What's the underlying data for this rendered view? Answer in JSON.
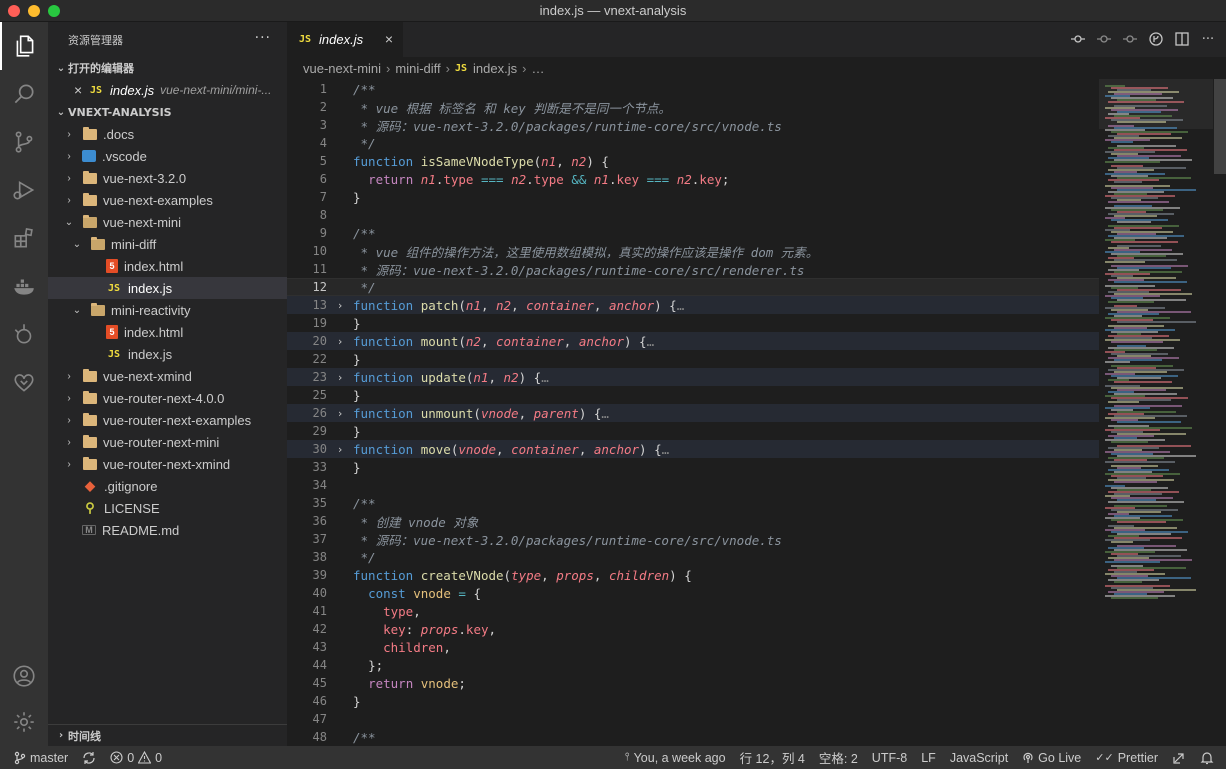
{
  "window": {
    "title": "index.js — vnext-analysis"
  },
  "activity_bar": {
    "items": [
      {
        "name": "explorer-icon"
      },
      {
        "name": "search-icon"
      },
      {
        "name": "source-control-icon"
      },
      {
        "name": "run-debug-icon"
      },
      {
        "name": "extensions-icon"
      },
      {
        "name": "docker-icon"
      },
      {
        "name": "git-graph-icon"
      },
      {
        "name": "live-share-icon"
      }
    ],
    "bottom": [
      {
        "name": "account-icon"
      },
      {
        "name": "settings-gear-icon"
      }
    ]
  },
  "sidebar": {
    "header": "资源管理器",
    "header_more": "···",
    "open_editors": {
      "title": "打开的编辑器",
      "items": [
        {
          "close": "×",
          "name": "index.js",
          "path": "vue-next-mini/mini-..."
        }
      ]
    },
    "workspace": {
      "title": "VNEXT-ANALYSIS",
      "tree": [
        {
          "label": ".docs",
          "icon": "folder-icon",
          "depth": 1,
          "chevron": "›"
        },
        {
          "label": ".vscode",
          "icon": "vscode-folder-icon",
          "depth": 1,
          "chevron": "›"
        },
        {
          "label": "vue-next-3.2.0",
          "icon": "folder-icon",
          "depth": 1,
          "chevron": "›"
        },
        {
          "label": "vue-next-examples",
          "icon": "folder-icon",
          "depth": 1,
          "chevron": "›"
        },
        {
          "label": "vue-next-mini",
          "icon": "folder-open-icon",
          "depth": 1,
          "chevron": "⌄"
        },
        {
          "label": "mini-diff",
          "icon": "folder-open-icon",
          "depth": 2,
          "chevron": "⌄"
        },
        {
          "label": "index.html",
          "icon": "html-file-icon",
          "depth": 3,
          "chevron": ""
        },
        {
          "label": "index.js",
          "icon": "js-file-icon",
          "depth": 3,
          "chevron": "",
          "selected": true
        },
        {
          "label": "mini-reactivity",
          "icon": "folder-open-icon",
          "depth": 2,
          "chevron": "⌄"
        },
        {
          "label": "index.html",
          "icon": "html-file-icon",
          "depth": 3,
          "chevron": ""
        },
        {
          "label": "index.js",
          "icon": "js-file-icon",
          "depth": 3,
          "chevron": ""
        },
        {
          "label": "vue-next-xmind",
          "icon": "folder-icon",
          "depth": 1,
          "chevron": "›"
        },
        {
          "label": "vue-router-next-4.0.0",
          "icon": "folder-icon",
          "depth": 1,
          "chevron": "›"
        },
        {
          "label": "vue-router-next-examples",
          "icon": "folder-icon",
          "depth": 1,
          "chevron": "›"
        },
        {
          "label": "vue-router-next-mini",
          "icon": "folder-icon",
          "depth": 1,
          "chevron": "›"
        },
        {
          "label": "vue-router-next-xmind",
          "icon": "folder-icon",
          "depth": 1,
          "chevron": "›"
        },
        {
          "label": ".gitignore",
          "icon": "git-file-icon",
          "depth": 1,
          "chevron": ""
        },
        {
          "label": "LICENSE",
          "icon": "license-file-icon",
          "depth": 1,
          "chevron": ""
        },
        {
          "label": "README.md",
          "icon": "markdown-file-icon",
          "depth": 1,
          "chevron": ""
        }
      ]
    },
    "timeline": "时间线"
  },
  "editor": {
    "tab": {
      "badge": "JS",
      "label": "index.js",
      "close": "×"
    },
    "breadcrumb": [
      "vue-next-mini",
      "mini-diff",
      "index.js",
      "…"
    ],
    "breadcrumb_badge": "JS",
    "actions": [
      "open-changes-icon",
      "previous-change-icon",
      "next-change-icon",
      "git-lens-icon",
      "split-editor-icon",
      "more-actions-icon"
    ],
    "current_line": 12,
    "lines": [
      {
        "n": "1",
        "t": [
          [
            "c-com",
            "/**"
          ]
        ]
      },
      {
        "n": "2",
        "t": [
          [
            "c-com",
            " * vue 根据 标签名 和 key 判断是不是同一个节点。"
          ]
        ]
      },
      {
        "n": "3",
        "t": [
          [
            "c-com",
            " * 源码：vue-next-3.2.0/packages/runtime-core/src/vnode.ts"
          ]
        ]
      },
      {
        "n": "4",
        "t": [
          [
            "c-com",
            " */"
          ]
        ]
      },
      {
        "n": "5",
        "t": [
          [
            "c-kw",
            "function "
          ],
          [
            "c-fn",
            "isSameVNodeType"
          ],
          [
            "c-punc",
            "("
          ],
          [
            "c-par",
            "n1"
          ],
          [
            "c-punc",
            ", "
          ],
          [
            "c-par",
            "n2"
          ],
          [
            "c-punc",
            ") {"
          ]
        ]
      },
      {
        "n": "6",
        "t": [
          [
            "c-def",
            "  "
          ],
          [
            "c-ctl",
            "return "
          ],
          [
            "c-par",
            "n1"
          ],
          [
            "c-punc",
            "."
          ],
          [
            "c-prop",
            "type"
          ],
          [
            "c-op",
            " === "
          ],
          [
            "c-par",
            "n2"
          ],
          [
            "c-punc",
            "."
          ],
          [
            "c-prop",
            "type"
          ],
          [
            "c-op",
            " && "
          ],
          [
            "c-par",
            "n1"
          ],
          [
            "c-punc",
            "."
          ],
          [
            "c-prop",
            "key"
          ],
          [
            "c-op",
            " === "
          ],
          [
            "c-par",
            "n2"
          ],
          [
            "c-punc",
            "."
          ],
          [
            "c-prop",
            "key"
          ],
          [
            "c-punc",
            ";"
          ]
        ]
      },
      {
        "n": "7",
        "t": [
          [
            "c-punc",
            "}"
          ]
        ]
      },
      {
        "n": "8",
        "t": []
      },
      {
        "n": "9",
        "t": [
          [
            "c-com",
            "/**"
          ]
        ]
      },
      {
        "n": "10",
        "t": [
          [
            "c-com",
            " * vue 组件的操作方法，这里使用数组模拟，真实的操作应该是操作 dom 元素。"
          ]
        ]
      },
      {
        "n": "11",
        "t": [
          [
            "c-com",
            " * 源码：vue-next-3.2.0/packages/runtime-core/src/renderer.ts"
          ]
        ]
      },
      {
        "n": "12",
        "t": [
          [
            "c-com",
            " */"
          ]
        ],
        "current": true
      },
      {
        "n": "13",
        "fold": "›",
        "folded": true,
        "t": [
          [
            "c-kw",
            "function "
          ],
          [
            "c-fn",
            "patch"
          ],
          [
            "c-punc",
            "("
          ],
          [
            "c-par",
            "n1"
          ],
          [
            "c-punc",
            ", "
          ],
          [
            "c-par",
            "n2"
          ],
          [
            "c-punc",
            ", "
          ],
          [
            "c-par",
            "container"
          ],
          [
            "c-punc",
            ", "
          ],
          [
            "c-par",
            "anchor"
          ],
          [
            "c-punc",
            ") {"
          ],
          [
            "c-ell",
            "…"
          ]
        ]
      },
      {
        "n": "19",
        "t": [
          [
            "c-punc",
            "}"
          ]
        ]
      },
      {
        "n": "20",
        "fold": "›",
        "folded": true,
        "t": [
          [
            "c-kw",
            "function "
          ],
          [
            "c-fn",
            "mount"
          ],
          [
            "c-punc",
            "("
          ],
          [
            "c-par",
            "n2"
          ],
          [
            "c-punc",
            ", "
          ],
          [
            "c-par",
            "container"
          ],
          [
            "c-punc",
            ", "
          ],
          [
            "c-par",
            "anchor"
          ],
          [
            "c-punc",
            ") {"
          ],
          [
            "c-ell",
            "…"
          ]
        ]
      },
      {
        "n": "22",
        "t": [
          [
            "c-punc",
            "}"
          ]
        ]
      },
      {
        "n": "23",
        "fold": "›",
        "folded": true,
        "t": [
          [
            "c-kw",
            "function "
          ],
          [
            "c-fn",
            "update"
          ],
          [
            "c-punc",
            "("
          ],
          [
            "c-par",
            "n1"
          ],
          [
            "c-punc",
            ", "
          ],
          [
            "c-par",
            "n2"
          ],
          [
            "c-punc",
            ") {"
          ],
          [
            "c-ell",
            "…"
          ]
        ]
      },
      {
        "n": "25",
        "t": [
          [
            "c-punc",
            "}"
          ]
        ]
      },
      {
        "n": "26",
        "fold": "›",
        "folded": true,
        "t": [
          [
            "c-kw",
            "function "
          ],
          [
            "c-fn",
            "unmount"
          ],
          [
            "c-punc",
            "("
          ],
          [
            "c-par",
            "vnode"
          ],
          [
            "c-punc",
            ", "
          ],
          [
            "c-par",
            "parent"
          ],
          [
            "c-punc",
            ") {"
          ],
          [
            "c-ell",
            "…"
          ]
        ]
      },
      {
        "n": "29",
        "t": [
          [
            "c-punc",
            "}"
          ]
        ]
      },
      {
        "n": "30",
        "fold": "›",
        "folded": true,
        "t": [
          [
            "c-kw",
            "function "
          ],
          [
            "c-fn",
            "move"
          ],
          [
            "c-punc",
            "("
          ],
          [
            "c-par",
            "vnode"
          ],
          [
            "c-punc",
            ", "
          ],
          [
            "c-par",
            "container"
          ],
          [
            "c-punc",
            ", "
          ],
          [
            "c-par",
            "anchor"
          ],
          [
            "c-punc",
            ") {"
          ],
          [
            "c-ell",
            "…"
          ]
        ]
      },
      {
        "n": "33",
        "t": [
          [
            "c-punc",
            "}"
          ]
        ]
      },
      {
        "n": "34",
        "t": []
      },
      {
        "n": "35",
        "t": [
          [
            "c-com",
            "/**"
          ]
        ]
      },
      {
        "n": "36",
        "t": [
          [
            "c-com",
            " * 创建 vnode 对象"
          ]
        ]
      },
      {
        "n": "37",
        "t": [
          [
            "c-com",
            " * 源码：vue-next-3.2.0/packages/runtime-core/src/vnode.ts"
          ]
        ]
      },
      {
        "n": "38",
        "t": [
          [
            "c-com",
            " */"
          ]
        ]
      },
      {
        "n": "39",
        "t": [
          [
            "c-kw",
            "function "
          ],
          [
            "c-fn",
            "createVNode"
          ],
          [
            "c-punc",
            "("
          ],
          [
            "c-par",
            "type"
          ],
          [
            "c-punc",
            ", "
          ],
          [
            "c-par",
            "props"
          ],
          [
            "c-punc",
            ", "
          ],
          [
            "c-par",
            "children"
          ],
          [
            "c-punc",
            ") {"
          ]
        ]
      },
      {
        "n": "40",
        "t": [
          [
            "c-def",
            "  "
          ],
          [
            "c-kw",
            "const "
          ],
          [
            "c-var",
            "vnode"
          ],
          [
            "c-op",
            " = "
          ],
          [
            "c-punc",
            "{"
          ]
        ]
      },
      {
        "n": "41",
        "t": [
          [
            "c-def",
            "    "
          ],
          [
            "c-prop",
            "type"
          ],
          [
            "c-punc",
            ","
          ]
        ]
      },
      {
        "n": "42",
        "t": [
          [
            "c-def",
            "    "
          ],
          [
            "c-prop",
            "key"
          ],
          [
            "c-punc",
            ": "
          ],
          [
            "c-par",
            "props"
          ],
          [
            "c-punc",
            "."
          ],
          [
            "c-prop",
            "key"
          ],
          [
            "c-punc",
            ","
          ]
        ]
      },
      {
        "n": "43",
        "t": [
          [
            "c-def",
            "    "
          ],
          [
            "c-prop",
            "children"
          ],
          [
            "c-punc",
            ","
          ]
        ]
      },
      {
        "n": "44",
        "t": [
          [
            "c-def",
            "  "
          ],
          [
            "c-punc",
            "};"
          ]
        ]
      },
      {
        "n": "45",
        "t": [
          [
            "c-def",
            "  "
          ],
          [
            "c-ctl",
            "return "
          ],
          [
            "c-var",
            "vnode"
          ],
          [
            "c-punc",
            ";"
          ]
        ]
      },
      {
        "n": "46",
        "t": [
          [
            "c-punc",
            "}"
          ]
        ]
      },
      {
        "n": "47",
        "t": []
      },
      {
        "n": "48",
        "t": [
          [
            "c-com",
            "/**"
          ]
        ]
      }
    ]
  },
  "statusbar": {
    "branch": "master",
    "sync_icon": "sync-icon",
    "errors": "0",
    "warnings": "0",
    "blame": "You, a week ago",
    "cursor": "行 12，列 4",
    "indent": "空格: 2",
    "encoding": "UTF-8",
    "eol": "LF",
    "language": "JavaScript",
    "golive": "Go Live",
    "prettier": "Prettier"
  },
  "colors": {
    "activity_bar": "#333333",
    "sidebar": "#252526",
    "editor": "#1e1e1e",
    "statusbar": "#333333",
    "keyword": "#569cd6",
    "function": "#dcdcaa",
    "parameter": "#f47b85"
  }
}
